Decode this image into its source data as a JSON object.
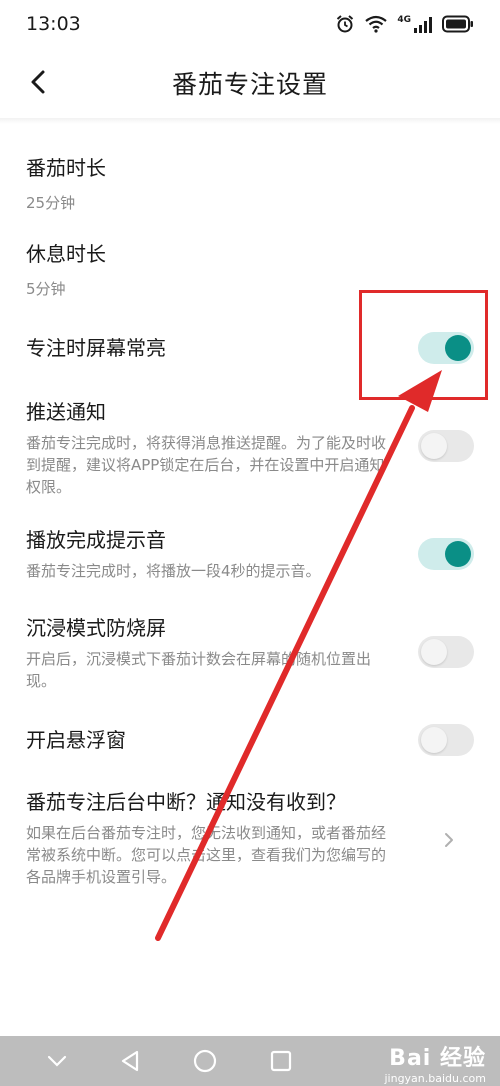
{
  "status_bar": {
    "time": "13:03",
    "network": "4G"
  },
  "header": {
    "title": "番茄专注设置"
  },
  "settings": [
    {
      "title": "番茄时长",
      "value": "25分钟"
    },
    {
      "title": "休息时长",
      "value": "5分钟"
    },
    {
      "title": "专注时屏幕常亮",
      "toggle": true
    },
    {
      "title": "推送通知",
      "subtitle": "番茄专注完成时，将获得消息推送提醒。为了能及时收到提醒，建议将APP锁定在后台，并在设置中开启通知权限。",
      "toggle": false
    },
    {
      "title": "播放完成提示音",
      "subtitle": "番茄专注完成时，将播放一段4秒的提示音。",
      "toggle": true
    },
    {
      "title": "沉浸模式防烧屏",
      "subtitle": "开启后，沉浸模式下番茄计数会在屏幕的随机位置出现。",
      "toggle": false
    },
    {
      "title": "开启悬浮窗",
      "toggle": false
    },
    {
      "title": "番茄专注后台中断？通知没有收到？",
      "subtitle": "如果在后台番茄专注时，您无法收到通知，或者番茄经常被系统中断。您可以点击这里，查看我们为您编写的各品牌手机设置引导。"
    }
  ],
  "watermark": {
    "logo": "Bai 经验",
    "url": "jingyan.baidu.com"
  },
  "colors": {
    "accent": "#0a8f86",
    "toggle_on_track": "#cfeceb",
    "toggle_off_track": "#e8e8e8",
    "annotation": "#e02a2a"
  }
}
